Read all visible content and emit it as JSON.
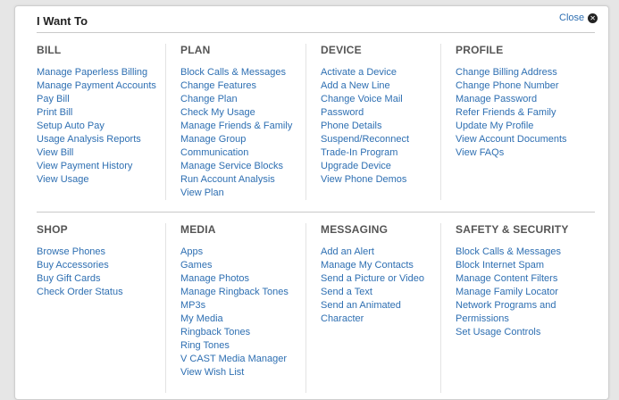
{
  "title": "I Want To",
  "close_label": "Close",
  "row1": [
    {
      "heading": "BILL",
      "links": [
        "Manage Paperless Billing",
        "Manage Payment Accounts",
        "Pay Bill",
        "Print Bill",
        "Setup Auto Pay",
        "Usage Analysis Reports",
        "View Bill",
        "View Payment History",
        "View Usage"
      ]
    },
    {
      "heading": "PLAN",
      "links": [
        "Block Calls & Messages",
        "Change Features",
        "Change Plan",
        "Check My Usage",
        "Manage Friends & Family",
        "Manage Group",
        "Communication",
        "Manage Service Blocks",
        "Run Account Analysis",
        "View Plan"
      ]
    },
    {
      "heading": "DEVICE",
      "links": [
        "Activate a Device",
        "Add a New Line",
        "Change Voice Mail",
        "Password",
        "Phone Details",
        "Suspend/Reconnect",
        "Trade-In Program",
        "Upgrade Device",
        "View Phone Demos"
      ]
    },
    {
      "heading": "PROFILE",
      "links": [
        "Change Billing Address",
        "Change Phone Number",
        "Manage Password",
        "Refer Friends & Family",
        "Update My Profile",
        "View Account Documents",
        "View FAQs"
      ]
    }
  ],
  "row2": [
    {
      "heading": "SHOP",
      "links": [
        "Browse Phones",
        "Buy Accessories",
        "Buy Gift Cards",
        "Check Order Status"
      ]
    },
    {
      "heading": "MEDIA",
      "links": [
        "Apps",
        "Games",
        "Manage Photos",
        "Manage Ringback Tones",
        "MP3s",
        "My Media",
        "Ringback Tones",
        "Ring Tones",
        "V CAST Media Manager",
        "View Wish List"
      ]
    },
    {
      "heading": "MESSAGING",
      "links": [
        "Add an Alert",
        "Manage My Contacts",
        "Send a Picture or Video",
        "Send a Text",
        "Send an Animated",
        "Character"
      ]
    },
    {
      "heading": "SAFETY & SECURITY",
      "links": [
        "Block Calls & Messages",
        "Block Internet Spam",
        "Manage Content Filters",
        "Manage Family Locator",
        "Network Programs and",
        "Permissions",
        "Set Usage Controls"
      ]
    }
  ],
  "colors": {
    "link": "#2e6fb2",
    "heading": "#555555"
  }
}
